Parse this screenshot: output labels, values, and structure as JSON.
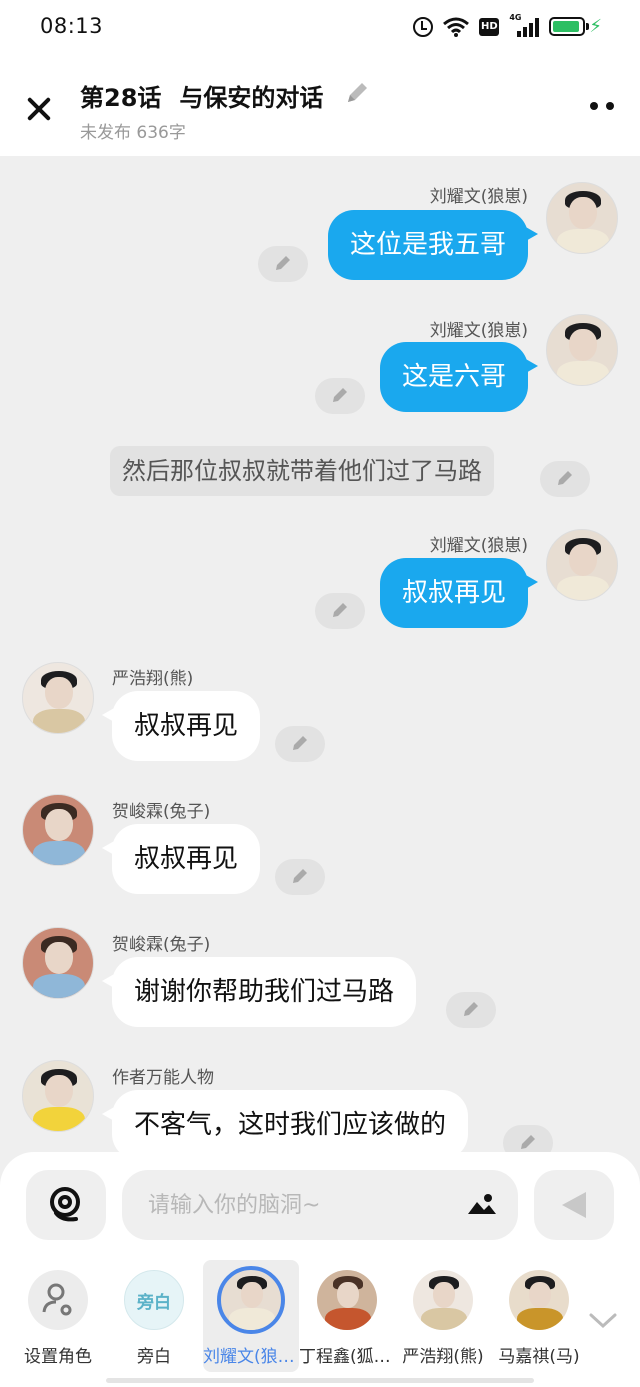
{
  "status_bar": {
    "time": "08:13",
    "hd_label": "HD",
    "net_label": "4G"
  },
  "header": {
    "episode": "第28话",
    "episode_name": "与保安的对话",
    "status": "未发布 636字"
  },
  "messages": [
    {
      "type": "right",
      "name": "刘耀文(狼崽)",
      "text": "这位是我五哥"
    },
    {
      "type": "right",
      "name": "刘耀文(狼崽)",
      "text": "这是六哥"
    },
    {
      "type": "narration",
      "text": "然后那位叔叔就带着他们过了马路"
    },
    {
      "type": "right",
      "name": "刘耀文(狼崽)",
      "text": "叔叔再见"
    },
    {
      "type": "left",
      "name": "严浩翔(熊)",
      "text": "叔叔再见"
    },
    {
      "type": "left",
      "name": "贺峻霖(兔子)",
      "text": "叔叔再见"
    },
    {
      "type": "left",
      "name": "贺峻霖(兔子)",
      "text": "谢谢你帮助我们过马路"
    },
    {
      "type": "left",
      "name": "作者万能人物",
      "text": "不客气，这时我们应该做的"
    }
  ],
  "input": {
    "placeholder": "请输入你的脑洞~"
  },
  "roles": [
    {
      "label": "设置角色",
      "kind": "settings"
    },
    {
      "label": "旁白",
      "kind": "narration",
      "icon_text": "旁白"
    },
    {
      "label": "刘耀文(狼崽)",
      "kind": "avatar",
      "selected": true
    },
    {
      "label": "丁程鑫(狐狸)",
      "kind": "avatar"
    },
    {
      "label": "严浩翔(熊)",
      "kind": "avatar"
    },
    {
      "label": "马嘉祺(马)",
      "kind": "avatar"
    }
  ],
  "colors": {
    "accent_bubble": "#1aa8ee",
    "selected_role": "#4a86e8",
    "background": "#efefef"
  },
  "icons": [
    "close-icon",
    "pencil-icon",
    "more-icon",
    "brain-icon",
    "image-icon",
    "send-icon",
    "chevron-down-icon",
    "role-settings-icon"
  ]
}
